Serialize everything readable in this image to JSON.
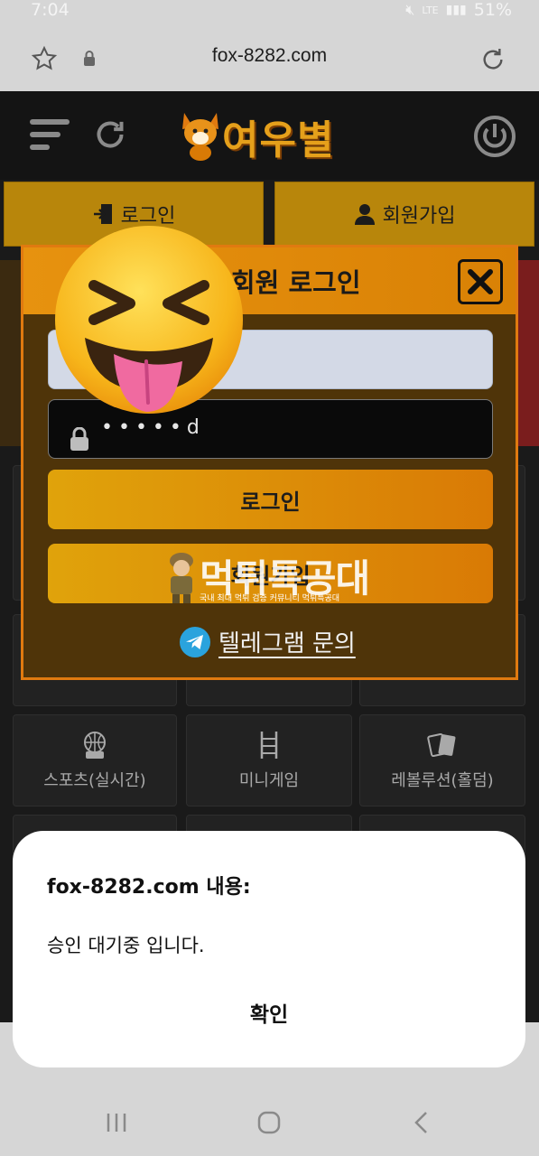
{
  "status_bar": {
    "time": "7:04",
    "battery": "51%",
    "network": "LTE"
  },
  "browser": {
    "url": "fox-8282.com"
  },
  "site": {
    "logo": "여우별",
    "login_label": "로그인",
    "join_label": "회원가입"
  },
  "tiles": [
    {
      "label": "스포츠(실시간)"
    },
    {
      "label": "미니게임"
    },
    {
      "label": "레볼루션(홀덤)"
    }
  ],
  "modal": {
    "title": "회원 로그인",
    "id_placeholder": "",
    "password_value": "•••••d",
    "login_button": "로그인",
    "join_button": "회원가입",
    "telegram_label": "텔레그램 문의"
  },
  "watermark": {
    "title": "먹튀특공대",
    "subtitle": "국내 최대 먹튀 검증 커뮤니티 먹튀특공대"
  },
  "dialog": {
    "title": "fox-8282.com 내용:",
    "message": "승인 대기중 입니다.",
    "ok_label": "확인"
  },
  "colors": {
    "accent": "#e0a30b",
    "modal_border": "#e07a10",
    "header_bg": "#141414"
  }
}
